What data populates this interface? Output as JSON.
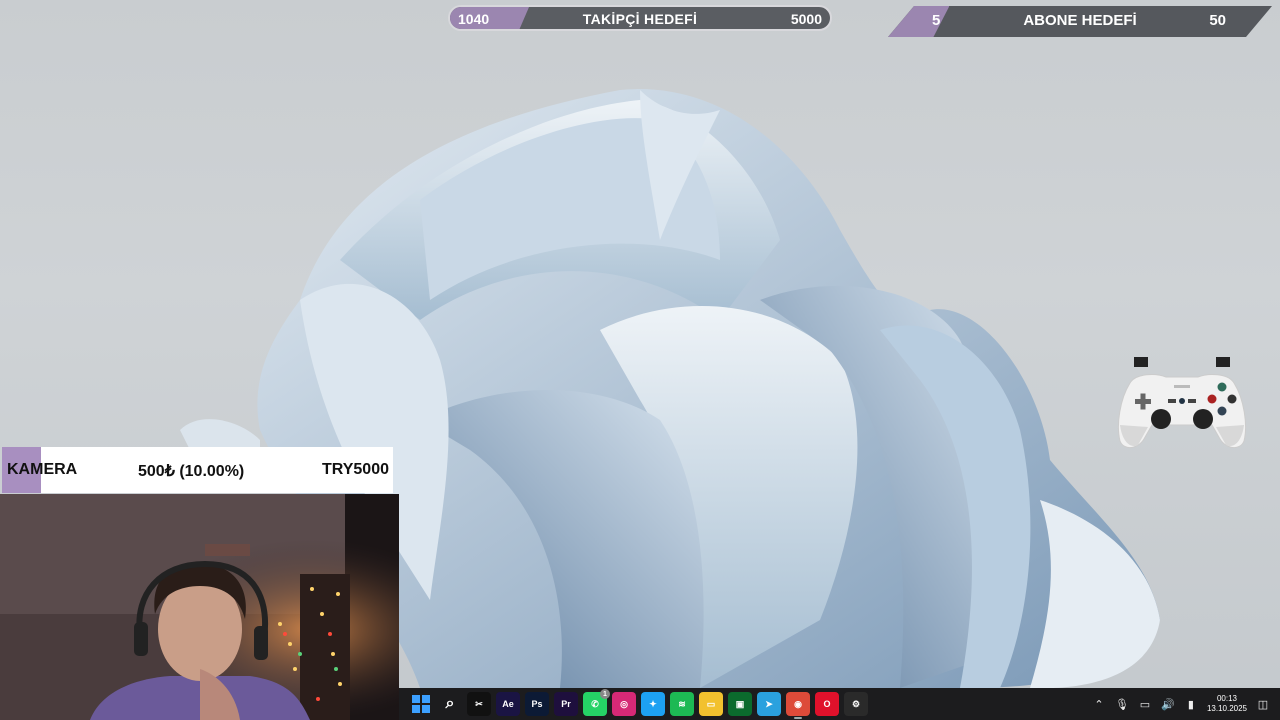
{
  "follower_goal": {
    "current": "1040",
    "title": "TAKİPÇİ HEDEFİ",
    "target": "5000",
    "progress_fraction": 0.208
  },
  "subscriber_goal": {
    "current": "5",
    "title": "ABONE HEDEFİ",
    "target": "50",
    "progress_fraction": 0.1
  },
  "donation_goal": {
    "label": "KAMERA",
    "amount": "500₺ (10.00%)",
    "goal": "TRY5000",
    "progress_fraction": 0.1
  },
  "taskbar": {
    "apps": [
      {
        "name": "windows-start",
        "glyph": "",
        "color": "#2b8cff"
      },
      {
        "name": "search",
        "glyph": "⌕",
        "color": "transparent"
      },
      {
        "name": "capcut",
        "glyph": "✂",
        "color": "#111111"
      },
      {
        "name": "after-effects",
        "glyph": "Ae",
        "color": "#1a1443"
      },
      {
        "name": "photoshop",
        "glyph": "Ps",
        "color": "#0c1a35"
      },
      {
        "name": "premiere",
        "glyph": "Pr",
        "color": "#1e0f3d"
      },
      {
        "name": "whatsapp",
        "glyph": "✆",
        "color": "#25d366",
        "badge": "1"
      },
      {
        "name": "instagram",
        "glyph": "◎",
        "color": "#d62976"
      },
      {
        "name": "twitter",
        "glyph": "✦",
        "color": "#1da1f2"
      },
      {
        "name": "spotify",
        "glyph": "≋",
        "color": "#1db954"
      },
      {
        "name": "file-explorer",
        "glyph": "▭",
        "color": "#f2c12e"
      },
      {
        "name": "terminal",
        "glyph": "▣",
        "color": "#0b6b2d"
      },
      {
        "name": "telegram",
        "glyph": "➤",
        "color": "#2aa1de"
      },
      {
        "name": "chrome",
        "glyph": "◉",
        "color": "#dd4b39",
        "active": true
      },
      {
        "name": "opera",
        "glyph": "O",
        "color": "#e0112b"
      },
      {
        "name": "steam",
        "glyph": "⚙",
        "color": "#2a2a2a"
      }
    ],
    "clock_time": "00:13",
    "clock_date": "13.10.2025"
  },
  "colors": {
    "accent": "#9b86b0",
    "bar_dark": "#55585d",
    "taskbar": "#1c1c1e"
  }
}
